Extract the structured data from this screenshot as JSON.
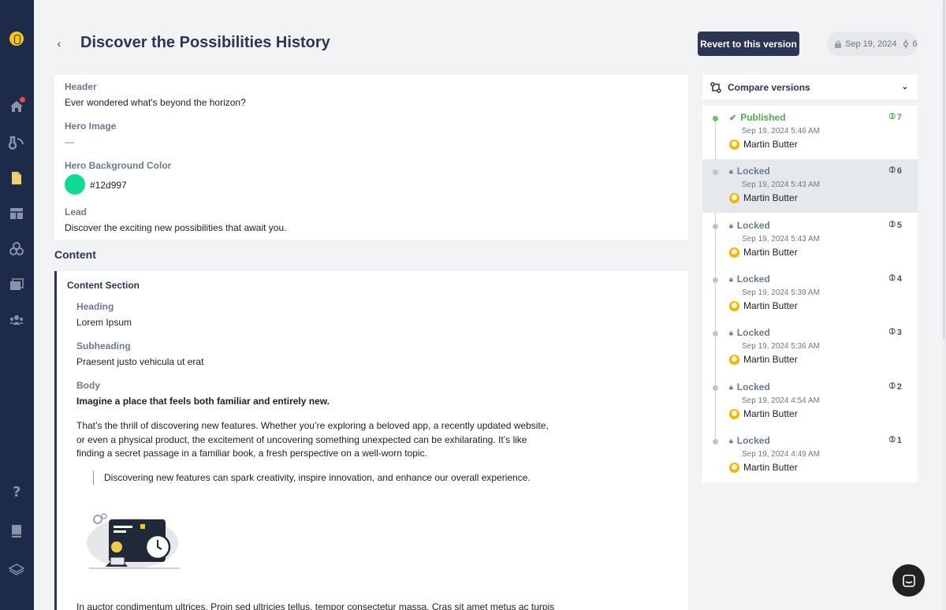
{
  "header": {
    "back_icon": "chevron-left-icon",
    "title": "Discover the Possibilities History",
    "revert_label": "Revert to this version",
    "current_date": "Sep 19, 2024",
    "current_version": "6"
  },
  "fields": {
    "header_label": "Header",
    "header_value": "Ever wondered what's beyond the horizon?",
    "hero_image_label": "Hero Image",
    "hero_image_value": "—",
    "hero_bg_label": "Hero Background Color",
    "hero_bg_value": "#12d997",
    "hero_bg_color": "#12d997",
    "lead_label": "Lead",
    "lead_value": "Discover the exciting new possibilities that await you."
  },
  "content": {
    "section_title": "Content",
    "block_title": "Content Section",
    "heading_label": "Heading",
    "heading_value": "Lorem Ipsum",
    "subheading_label": "Subheading",
    "subheading_value": "Praesent justo vehicula ut erat",
    "body_label": "Body",
    "body_intro": "Imagine a place that feels both familiar and entirely new.",
    "body_line1": "That’s the thrill of discovering new features. Whether you’re exploring a beloved app, a recently updated website,",
    "body_line2": "or even a physical product, the excitement of uncovering something unexpected can be exhilarating. It’s like",
    "body_line3": "finding a secret passage in a familiar book, a fresh perspective on a well-worn topic.",
    "quote": "Discovering new features can spark creativity, inspire innovation, and enhance our overall experience.",
    "tail": "In auctor condimentum ultrices. Proin sed ultricies tellus, tempor consectetur massa. Cras sit amet metus ac turpis"
  },
  "compare": {
    "label": "Compare versions"
  },
  "versions": [
    {
      "status": "Published",
      "date": "Sep 19, 2024 5:46 AM",
      "user": "Martin Butter",
      "number": "7"
    },
    {
      "status": "Locked",
      "date": "Sep 19, 2024 5:43 AM",
      "user": "Martin Butter",
      "number": "6"
    },
    {
      "status": "Locked",
      "date": "Sep 19, 2024 5:43 AM",
      "user": "Martin Butter",
      "number": "5"
    },
    {
      "status": "Locked",
      "date": "Sep 19, 2024 5:39 AM",
      "user": "Martin Butter",
      "number": "4"
    },
    {
      "status": "Locked",
      "date": "Sep 19, 2024 5:36 AM",
      "user": "Martin Butter",
      "number": "3"
    },
    {
      "status": "Locked",
      "date": "Sep 19, 2024 4:54 AM",
      "user": "Martin Butter",
      "number": "2"
    },
    {
      "status": "Locked",
      "date": "Sep 19, 2024 4:49 AM",
      "user": "Martin Butter",
      "number": "1"
    }
  ],
  "sidebar": {
    "icons": [
      "logo-icon",
      "home-icon",
      "blog-icon",
      "page-icon",
      "grid-icon",
      "components-icon",
      "media-icon",
      "users-icon",
      "help-icon",
      "book-icon",
      "layers-icon"
    ]
  }
}
